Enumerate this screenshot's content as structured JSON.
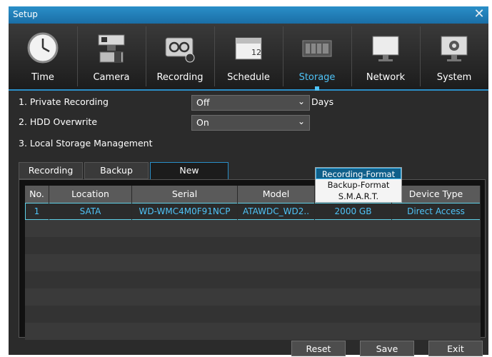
{
  "window": {
    "title": "Setup",
    "close_glyph": "✕"
  },
  "toolbar": {
    "items": [
      {
        "label": "Time",
        "icon": "clock-icon"
      },
      {
        "label": "Camera",
        "icon": "camera-icon"
      },
      {
        "label": "Recording",
        "icon": "recording-icon"
      },
      {
        "label": "Schedule",
        "icon": "calendar-icon"
      },
      {
        "label": "Storage",
        "icon": "storage-icon",
        "active": true
      },
      {
        "label": "Network",
        "icon": "monitor-icon"
      },
      {
        "label": "System",
        "icon": "system-icon"
      }
    ]
  },
  "settings": {
    "private_recording": {
      "label": "1. Private Recording",
      "value": "Off",
      "unit": "Days"
    },
    "hdd_overwrite": {
      "label": "2. HDD Overwrite",
      "value": "On"
    },
    "local_storage": {
      "label": "3. Local Storage Management"
    }
  },
  "tabs": [
    {
      "label": "Recording"
    },
    {
      "label": "Backup"
    },
    {
      "label": "New",
      "active": true
    }
  ],
  "table": {
    "columns": [
      "No.",
      "Location",
      "Serial",
      "Model",
      "",
      "Device Type"
    ],
    "rows": [
      {
        "no": "1",
        "location": "SATA",
        "serial": "WD-WMC4M0F91NCP",
        "model": "ATAWDC_WD2..",
        "size": "2000 GB",
        "device_type": "Direct Access"
      }
    ]
  },
  "popup_menu": {
    "items": [
      "Recording-Format",
      "Backup-Format",
      "S.M.A.R.T."
    ],
    "highlighted": "Recording-Format"
  },
  "buttons": {
    "reset": "Reset",
    "save": "Save",
    "exit": "Exit"
  },
  "colors": {
    "accent": "#4fc3f7",
    "titlebar": "#1a6ea6"
  }
}
